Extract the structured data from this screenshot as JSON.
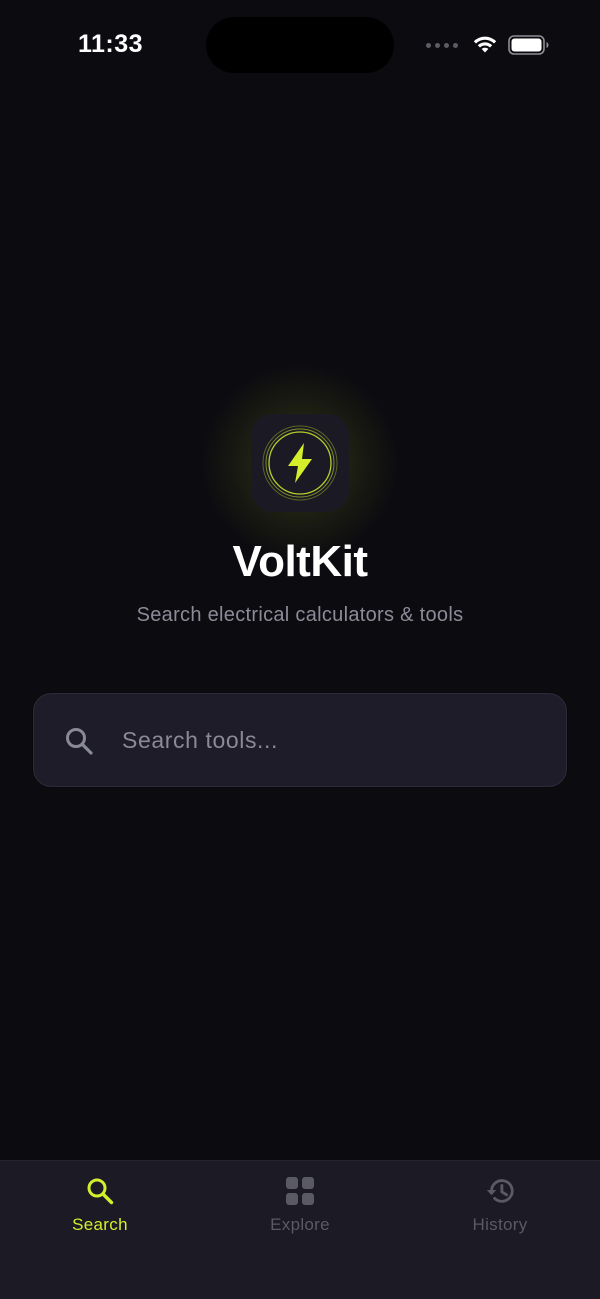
{
  "status_bar": {
    "time": "11:33"
  },
  "app": {
    "name": "VoltKit",
    "tagline": "Search electrical calculators & tools",
    "accent_color": "#d4ee2b"
  },
  "search": {
    "placeholder": "Search tools...",
    "value": "",
    "icon": "search-icon"
  },
  "tab_bar": {
    "tabs": [
      {
        "label": "Search",
        "icon": "search-icon",
        "active": true
      },
      {
        "label": "Explore",
        "icon": "grid-icon",
        "active": false
      },
      {
        "label": "History",
        "icon": "history-icon",
        "active": false
      }
    ]
  },
  "colors": {
    "background": "#0c0b10",
    "surface": "#1d1c28",
    "tab_bar": "#1b1a25",
    "muted_text": "#8c8b97",
    "inactive_tab": "#5a5966"
  }
}
